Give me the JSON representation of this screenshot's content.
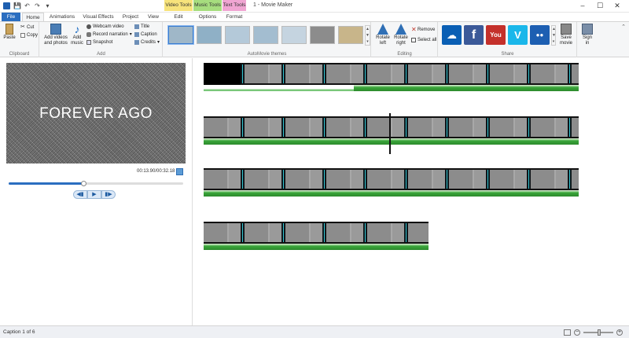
{
  "window": {
    "title": "1 - Movie Maker",
    "contextual_tabs": [
      "Video Tools",
      "Music Tools",
      "Text Tools"
    ],
    "controls": [
      "–",
      "☐",
      "✕"
    ]
  },
  "quick_access": {
    "icons": [
      "app-icon",
      "save-icon",
      "undo-icon",
      "redo-icon",
      "customize-icon"
    ]
  },
  "tabs": [
    "File",
    "Home",
    "Animations",
    "Visual Effects",
    "Project",
    "View",
    "Edit",
    "Options",
    "Format"
  ],
  "ribbon": {
    "clipboard": {
      "paste": "Paste",
      "cut": "Cut",
      "copy": "Copy",
      "label": "Clipboard"
    },
    "add": {
      "add_videos": "Add videos",
      "add_videos2": "and photos",
      "add_music": "Add",
      "add_music2": "music",
      "webcam": "Webcam video",
      "record": "Record narration",
      "snapshot": "Snapshot",
      "title": "Title",
      "caption": "Caption",
      "credits": "Credits",
      "label": "Add"
    },
    "themes": {
      "label": "AutoMovie themes",
      "count": 7
    },
    "editing": {
      "rotate_left": "Rotate",
      "rotate_left2": "left",
      "rotate_right": "Rotate",
      "rotate_right2": "right",
      "remove": "Remove",
      "select_all": "Select all",
      "label": "Editing"
    },
    "share": {
      "label": "Share",
      "services": [
        {
          "name": "onedrive",
          "glyph": "☁",
          "color": "#0a5fb4"
        },
        {
          "name": "facebook",
          "glyph": "f",
          "color": "#3b5998"
        },
        {
          "name": "youtube",
          "glyph": "You",
          "color": "#c4302b"
        },
        {
          "name": "vimeo",
          "glyph": "V",
          "color": "#1ab7ea"
        },
        {
          "name": "flickr",
          "glyph": "●●",
          "color": "#1d5fb2"
        }
      ],
      "save_movie": "Save",
      "save_movie2": "movie",
      "sign_in": "Sign",
      "sign_in2": "in"
    }
  },
  "preview": {
    "caption_text": "FOREVER AGO",
    "timecode": "00:13.90/00:32.18",
    "progress": 0.43,
    "controls": [
      "◀▮",
      "▶",
      "▮▶"
    ]
  },
  "status": {
    "text": "Caption 1 of 6"
  }
}
